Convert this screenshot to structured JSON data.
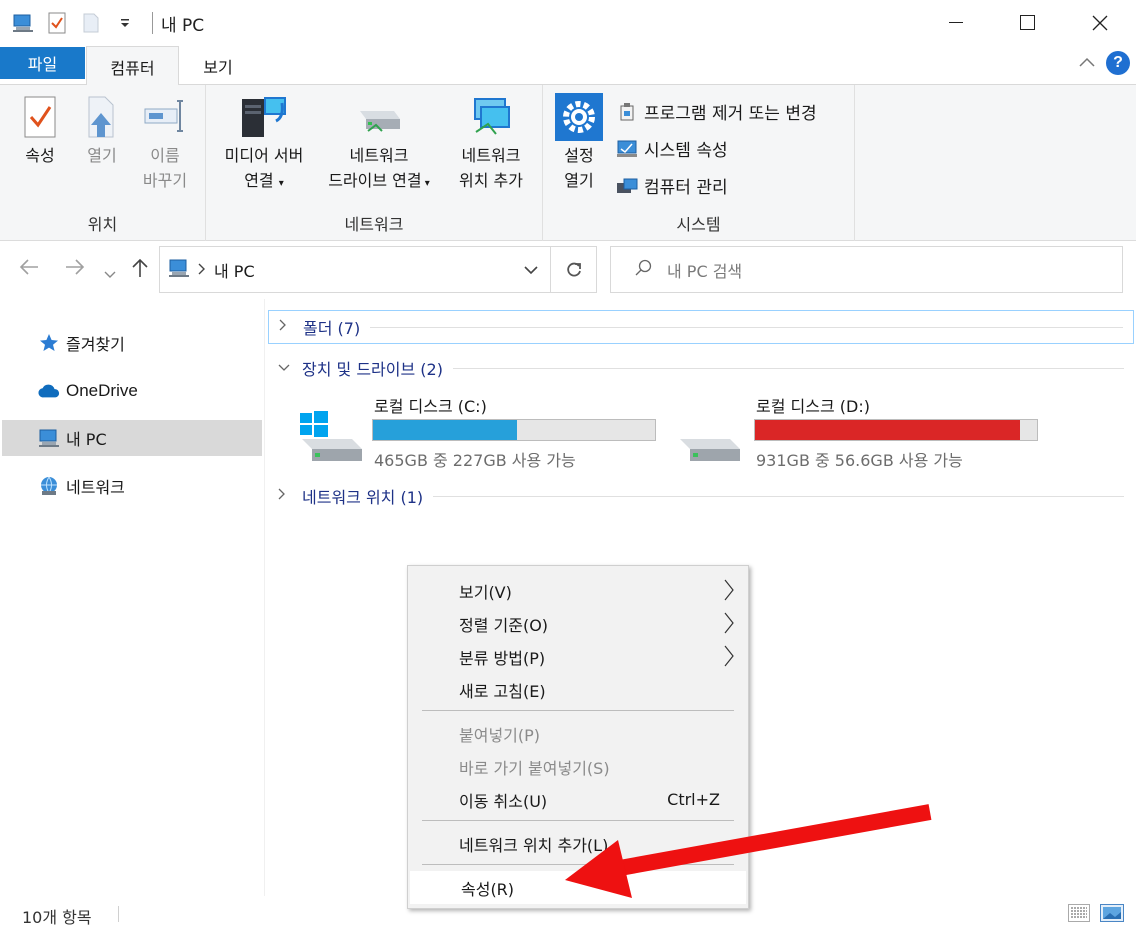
{
  "window": {
    "title": "내 PC"
  },
  "tabs": [
    {
      "label": "파일"
    },
    {
      "label": "컴퓨터"
    },
    {
      "label": "보기"
    }
  ],
  "ribbon": {
    "location": {
      "label": "위치",
      "properties": "속성",
      "open": "열기",
      "rename_line1": "이름",
      "rename_line2": "바꾸기"
    },
    "network": {
      "label": "네트워크",
      "media_line1": "미디어 서버",
      "media_line2": "연결",
      "map_line1": "네트워크",
      "map_line2": "드라이브 연결",
      "add_line1": "네트워크",
      "add_line2": "위치 추가"
    },
    "system": {
      "label": "시스템",
      "settings_line1": "설정",
      "settings_line2": "열기",
      "uninstall": "프로그램 제거 또는 변경",
      "sysprops": "시스템 속성",
      "manage": "컴퓨터 관리"
    }
  },
  "address": {
    "path": "내 PC",
    "search_placeholder": "내 PC 검색"
  },
  "sidebar": {
    "items": [
      {
        "label": "즐겨찾기"
      },
      {
        "label": "OneDrive"
      },
      {
        "label": "내 PC"
      },
      {
        "label": "네트워크"
      }
    ]
  },
  "content": {
    "folders": "폴더 (7)",
    "devices": "장치 및 드라이브 (2)",
    "network_locations": "네트워크 위치 (1)",
    "drives": [
      {
        "name": "로컬 디스크 (C:)",
        "usage": "465GB 중 227GB 사용 가능",
        "used_fraction": 0.51,
        "color": "#26a0da"
      },
      {
        "name": "로컬 디스크 (D:)",
        "usage": "931GB 중 56.6GB 사용 가능",
        "used_fraction": 0.94,
        "color": "#da2626"
      }
    ]
  },
  "context_menu": {
    "items": [
      {
        "label": "보기(V)"
      },
      {
        "label": "정렬 기준(O)"
      },
      {
        "label": "분류 방법(P)"
      },
      {
        "label": "새로 고침(E)"
      },
      {
        "label": "붙여넣기(P)"
      },
      {
        "label": "바로 가기 붙여넣기(S)"
      },
      {
        "label": "이동 취소(U)",
        "shortcut": "Ctrl+Z"
      },
      {
        "label": "네트워크 위치 추가(L)"
      },
      {
        "label": "속성(R)"
      }
    ]
  },
  "status": {
    "count": "10개 항목"
  },
  "colors": {
    "accent": "#1979ca",
    "annotation_arrow": "#ee1111"
  }
}
